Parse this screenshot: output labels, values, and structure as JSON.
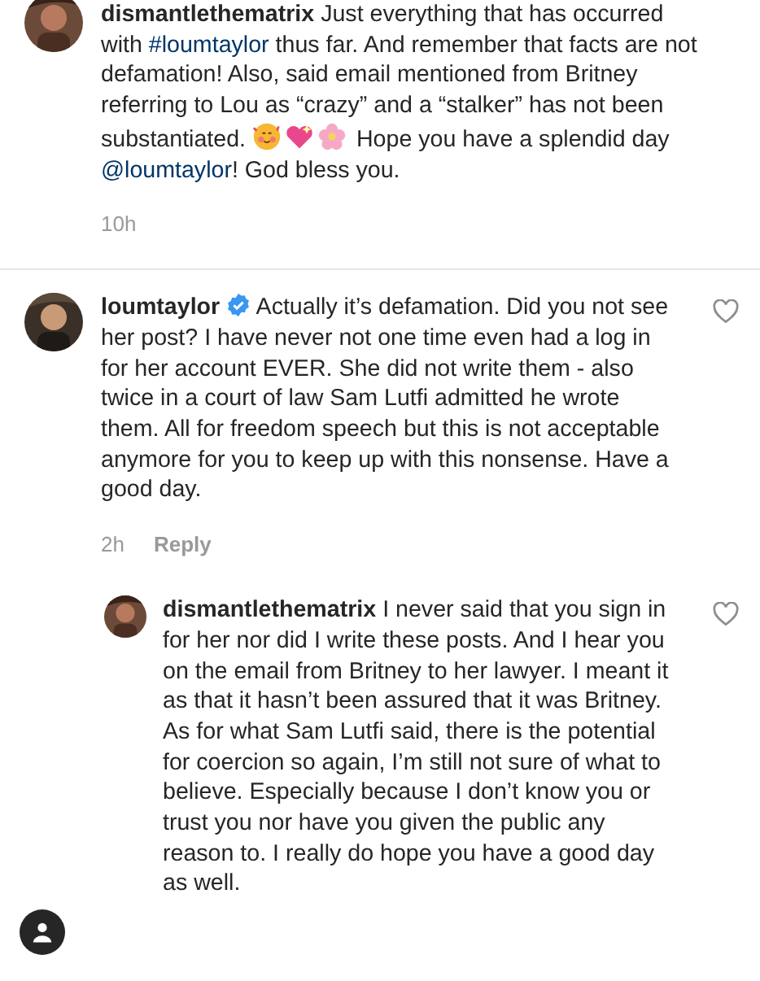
{
  "comments": [
    {
      "indent": false,
      "segments": [
        {
          "kind": "user",
          "text": "dismantlethematrix"
        },
        {
          "kind": "text",
          "text": " Just everything that has occurred with "
        },
        {
          "kind": "link",
          "text": "#loumtaylor"
        },
        {
          "kind": "text",
          "text": " thus far. And remember that facts are not defamation! Also, said email mentioned from Britney referring to Lou as “crazy” and a “stalker” has not been substantiated. "
        },
        {
          "kind": "emoji"
        },
        {
          "kind": "text",
          "text": " Hope you have a splendid day "
        },
        {
          "kind": "link",
          "text": "@loumtaylor"
        },
        {
          "kind": "text",
          "text": "! God bless you."
        }
      ],
      "time": "10h",
      "divider_after": true
    },
    {
      "indent": false,
      "liked": false,
      "verified": true,
      "segments": [
        {
          "kind": "user",
          "text": "loumtaylor"
        },
        {
          "kind": "badge"
        },
        {
          "kind": "text",
          "text": " Actually it’s defamation. Did you not see her post? I have never not one time even had a log in for her account EVER.  She did not write them - also twice in a court of law Sam Lutfi admitted he wrote them. All for freedom speech but this is not acceptable anymore for you to keep up with this nonsense. Have a good day."
        }
      ],
      "time": "2h",
      "reply": "Reply"
    },
    {
      "indent": true,
      "liked": false,
      "segments": [
        {
          "kind": "user",
          "text": "dismantlethematrix"
        },
        {
          "kind": "text",
          "text": " I never said that you sign in for her nor did I write these posts. And I hear you on the email from Britney to her lawyer. I meant it as that it hasn’t been assured that it was Britney. As for what Sam Lutfi said, there is the potential for coercion so again, I’m still not sure of what to believe. Especially because I don’t know you or trust you nor have you given the public any reason to. I really do hope you have a good day as well."
        }
      ]
    }
  ]
}
